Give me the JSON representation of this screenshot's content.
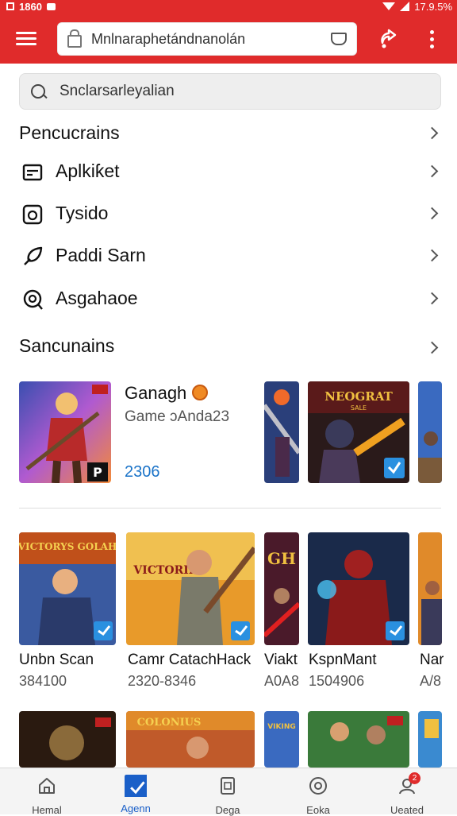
{
  "status_bar": {
    "time": "1860",
    "battery": "17.9.5%"
  },
  "app_bar": {
    "url": "Mnlnaraphetándnanolán"
  },
  "search": {
    "placeholder": "Snclarsarleyalian"
  },
  "section_one": {
    "title": "Pencucrains"
  },
  "menu": [
    {
      "label": "Aplkiƙet",
      "icon": "card-icon"
    },
    {
      "label": "Tysido",
      "icon": "camera-icon"
    },
    {
      "label": "Paddi Sarn",
      "icon": "leaf-icon"
    },
    {
      "label": "Asgahaoe",
      "icon": "location-icon"
    }
  ],
  "section_two": {
    "title": "Sancunains"
  },
  "featured": {
    "title": "Ganagh",
    "subtitle": "Game ɔAnda23",
    "count": "2306",
    "badge_text": "P"
  },
  "promo_tiles": [
    {
      "banner": "NEOGRAT",
      "sub": "SALE"
    }
  ],
  "game_banners": [
    "VICTORYS GOLAH",
    "VICTORIB",
    "GH"
  ],
  "games": [
    {
      "name": "Unbn Scan",
      "count": "384100"
    },
    {
      "name": "Camr CatachHack",
      "count": "2320-8346"
    },
    {
      "name": "Viakt",
      "count": "A0A8"
    },
    {
      "name": "KspnMant",
      "count": "1504906"
    },
    {
      "name": "Nar",
      "count": "A/8"
    }
  ],
  "row_three_banners": [
    "COLONIUS",
    "VIKING"
  ],
  "bottom_nav": [
    {
      "label": "Hemal",
      "icon": "home-icon"
    },
    {
      "label": "Agenn",
      "icon": "apps-icon"
    },
    {
      "label": "Dega",
      "icon": "document-icon"
    },
    {
      "label": "Eoka",
      "icon": "compass-icon"
    },
    {
      "label": "Ueated",
      "icon": "profile-icon",
      "badge": "2"
    }
  ],
  "colors": {
    "brand": "#e02b2b",
    "accent": "#1a73c8"
  }
}
